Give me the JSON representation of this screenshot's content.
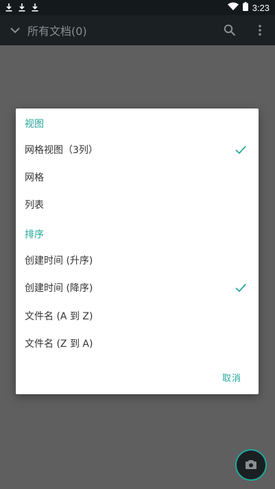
{
  "status_bar": {
    "time": "3:23",
    "left_icons": [
      "download-icon",
      "download-icon",
      "download-icon"
    ],
    "right_icons": [
      "wifi-icon",
      "battery-icon"
    ]
  },
  "app_bar": {
    "title": "所有文档(0)",
    "icons": [
      "chevron-down-icon",
      "search-icon",
      "more-vert-icon"
    ]
  },
  "dialog": {
    "view_header": "视图",
    "view_options": [
      {
        "label": "网格视图（3列）",
        "checked": true
      },
      {
        "label": "网格",
        "checked": false
      },
      {
        "label": "列表",
        "checked": false
      }
    ],
    "sort_header": "排序",
    "sort_options": [
      {
        "label": "创建时间 (升序)",
        "checked": false
      },
      {
        "label": "创建时间 (降序)",
        "checked": true
      },
      {
        "label": "文件名 (A 到 Z)",
        "checked": false
      },
      {
        "label": "文件名 (Z 到 A)",
        "checked": false
      }
    ],
    "cancel_label": "取消"
  },
  "fab_icon": "camera-icon",
  "colors": {
    "accent": "#22a89a",
    "status_bar": "#14191c",
    "app_bar": "#1b2023",
    "overlay": "#5f5f5f"
  }
}
